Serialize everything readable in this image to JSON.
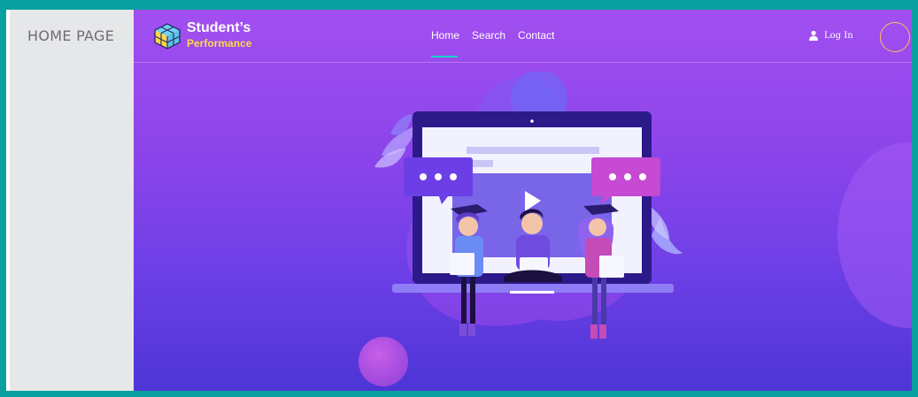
{
  "sidebar": {
    "title": "HOME PAGE"
  },
  "brand": {
    "title": "Student’s",
    "subtitle": "Performance"
  },
  "nav": {
    "items": [
      "Home",
      "Search",
      "Contact"
    ],
    "active_index": 0
  },
  "login": {
    "label": "Log In"
  },
  "colors": {
    "frame": "#0aa0a0",
    "sidebar_bg": "#e6e7e8",
    "hero_top": "#a24ff0",
    "hero_bottom": "#4d35d6",
    "accent_underline": "#19d3c5",
    "brand_subtitle": "#ffd84a"
  },
  "icons": [
    "cube-logo-icon",
    "user-icon"
  ]
}
